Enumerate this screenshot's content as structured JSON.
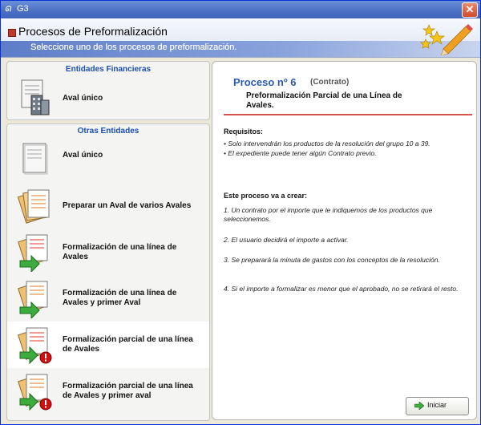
{
  "window": {
    "title": "G3",
    "close_glyph": "✕"
  },
  "header": {
    "title": "Procesos de Preformalización",
    "subtitle": "Seleccione uno de los procesos de preformalización."
  },
  "groups": [
    {
      "title": "Entidades Financieras",
      "items": [
        {
          "label": "Aval único",
          "icon": "building-document-icon"
        }
      ]
    },
    {
      "title": "Otras Entidades",
      "items": [
        {
          "label": "Aval único",
          "icon": "document-icon"
        },
        {
          "label": "Preparar un Aval de varios Avales",
          "icon": "stacked-documents-icon"
        },
        {
          "label": "Formalización de una línea de Avales",
          "icon": "documents-arrow-icon"
        },
        {
          "label": "Formalización de una línea de Avales y primer Aval",
          "icon": "documents-arrow-icon"
        },
        {
          "label": "Formalización parcial de una línea de Avales",
          "icon": "documents-arrow-warning-icon",
          "selected": true
        },
        {
          "label": "Formalización parcial de una línea de Avales y primer aval",
          "icon": "documents-arrow-warning-icon"
        }
      ]
    }
  ],
  "detail": {
    "title": "Proceso nº 6",
    "kind": "(Contrato)",
    "description": "Preformalización Parcial de una Línea de Avales.",
    "requirements_title": "Requisitos:",
    "requirements": [
      "• Solo intervendrán los productos de la resolución del grupo 10 a 39.",
      "• El expediente puede tener algún Contrato previo."
    ],
    "creates_title": "Este proceso va a crear:",
    "steps": [
      "1. Un contrato por el importe que le indiquemos de los productos que seleccionemos.",
      "2. El usuario decidirá el importe a activar.",
      "3. Se preparará la minuta de gastos con los conceptos de la resolución.",
      "4. Si el importe a formalizar es menor que el aprobado, no se retirará el resto."
    ],
    "start_button": "Iniciar"
  },
  "colors": {
    "accent": "#1c4fb3",
    "title_blue": "#2a5ab0",
    "separator_red": "#d9534f"
  }
}
